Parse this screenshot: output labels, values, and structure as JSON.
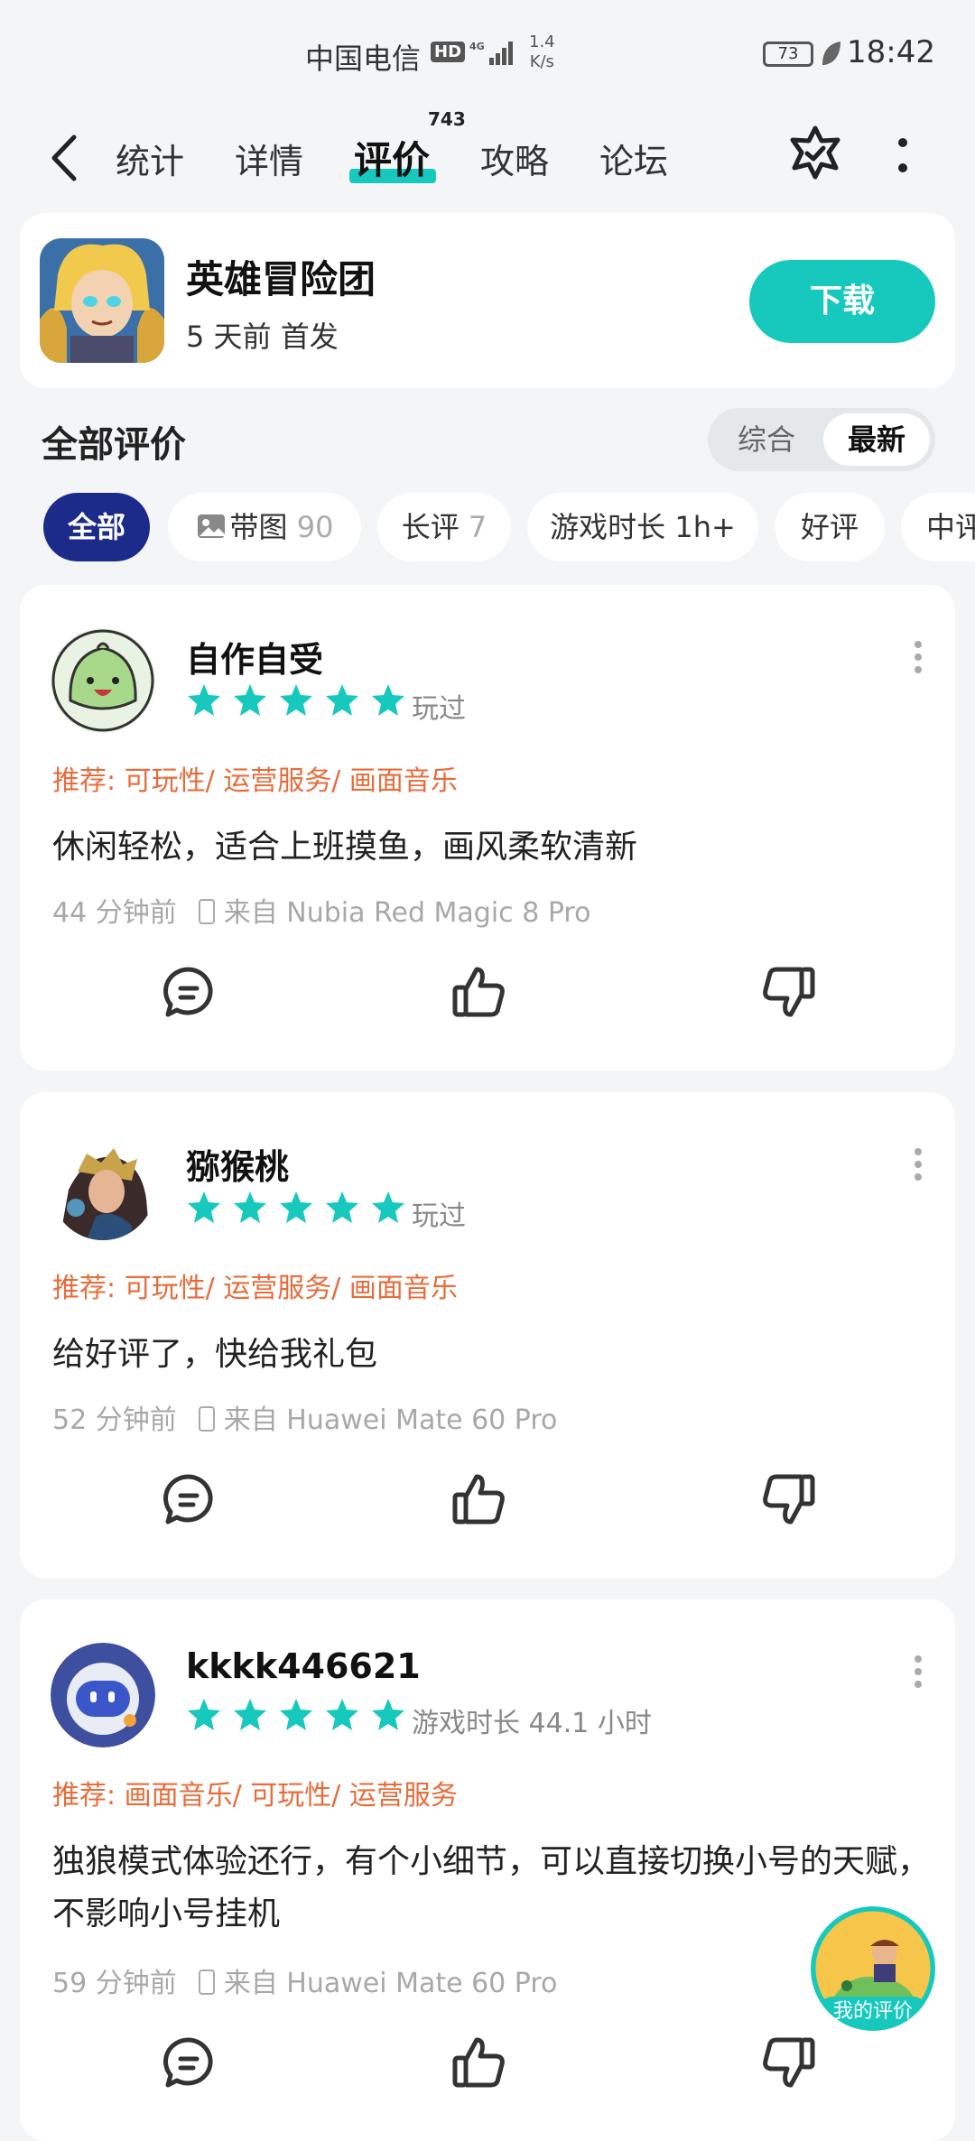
{
  "status_bar": {
    "carrier": "中国电信",
    "hd": "HD",
    "speed_value": "1.4",
    "speed_unit": "K/s",
    "battery": "73",
    "time": "18:42"
  },
  "nav": {
    "tabs": [
      {
        "label": "统计"
      },
      {
        "label": "详情"
      },
      {
        "label": "评价",
        "badge": "743",
        "active": true
      },
      {
        "label": "攻略"
      },
      {
        "label": "论坛"
      }
    ]
  },
  "game": {
    "title": "英雄冒险团",
    "subtitle": "5 天前 首发",
    "download_label": "下载"
  },
  "reviews_header": {
    "title": "全部评价",
    "sort_options": [
      "综合",
      "最新"
    ],
    "sort_selected": "最新"
  },
  "filters": [
    {
      "label": "全部",
      "active": true
    },
    {
      "label": "带图",
      "count": "90"
    },
    {
      "label": "长评",
      "count": "7"
    },
    {
      "label": "游戏时长 1h+"
    },
    {
      "label": "好评"
    },
    {
      "label": "中评"
    }
  ],
  "reviews": [
    {
      "user": "自作自受",
      "rating": 5,
      "played": "玩过",
      "tags": "推荐: 可玩性/ 运营服务/ 画面音乐",
      "text": "休闲轻松，适合上班摸鱼，画风柔软清新",
      "time": "44 分钟前",
      "device": "来自 Nubia Red Magic 8 Pro"
    },
    {
      "user": "猕猴桃",
      "rating": 5,
      "played": "玩过",
      "tags": "推荐: 可玩性/ 运营服务/ 画面音乐",
      "text": "给好评了，快给我礼包",
      "time": "52 分钟前",
      "device": "来自 Huawei Mate 60 Pro"
    },
    {
      "user": "kkkk446621",
      "rating": 5,
      "played": "游戏时长 44.1 小时",
      "tags": "推荐: 画面音乐/ 可玩性/ 运营服务",
      "text": "独狼模式体验还行，有个小细节，可以直接切换小号的天赋，不影响小号挂机",
      "time": "59 分钟前",
      "device": "来自 Huawei Mate 60 Pro"
    }
  ],
  "floating": {
    "label": "我的评价"
  },
  "colors": {
    "accent": "#16c9bc",
    "chip_active": "#1c2a8a",
    "tag": "#e96b3a",
    "star": "#16c9bc"
  }
}
